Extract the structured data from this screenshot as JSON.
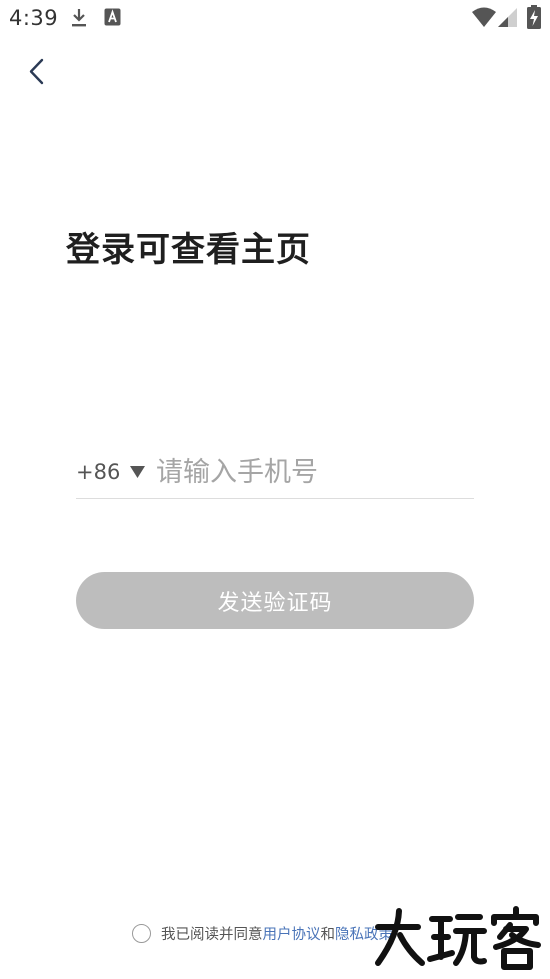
{
  "status_bar": {
    "time": "4:39",
    "icons": [
      "download-icon",
      "a-notification-icon",
      "wifi-icon",
      "signal-icon",
      "battery-charging-icon"
    ]
  },
  "nav": {
    "back_icon": "chevron-left-icon"
  },
  "title": "登录可查看主页",
  "phone_form": {
    "country_code": "+86",
    "country_caret_icon": "triangle-down-icon",
    "placeholder": "请输入手机号",
    "value": ""
  },
  "send_button": {
    "label": "发送验证码",
    "disabled": true
  },
  "agreement": {
    "prefix": "我已阅读并同意",
    "user_agreement": "用户协议",
    "and": "和",
    "privacy_policy": "隐私政策",
    "checked": false
  },
  "watermark": {
    "text": "大玩客"
  },
  "colors": {
    "background": "#ffffff",
    "button_disabled": "#bdbdbd",
    "link": "#4a74b8",
    "placeholder": "#a5a5a5",
    "title": "#1f1f1f"
  }
}
